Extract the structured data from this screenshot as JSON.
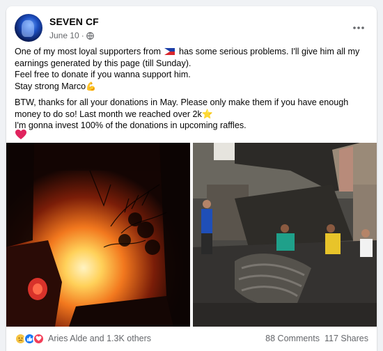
{
  "post": {
    "author": "SEVEN CF",
    "date": "June 10",
    "date_separator": "·",
    "more_icon": "more-dots-icon",
    "text": {
      "line1a": "One of my most loyal supporters from",
      "line1b": "has some serious problems. I'll give him all my earnings generated by this page (till Sunday).",
      "line2": "Feel free to donate if you wanna support him.",
      "line3": "Stay strong Marco",
      "line4": "BTW, thanks for all your donations in May. Please only make them if you have enough money to do so! Last month we reached over 2k",
      "line5": "I'm gonna invest 100% of the donations in upcoming raffles."
    },
    "emoji": {
      "flag": "philippines-flag-icon",
      "muscle": "💪",
      "star": "⭐",
      "heart": "heart-icon"
    },
    "photos": [
      {
        "name": "fire-at-night-photo"
      },
      {
        "name": "burned-houses-photo"
      }
    ]
  },
  "footer": {
    "reactions_label": "Aries Alde and 1.3K others",
    "reaction_icons": [
      "sad-reaction-icon",
      "like-reaction-icon",
      "love-reaction-icon"
    ],
    "comments": "88 Comments",
    "shares": "117 Shares"
  },
  "colors": {
    "accent": "#1877f2",
    "secondary_text": "#65676b",
    "background": "#f0f2f5"
  }
}
